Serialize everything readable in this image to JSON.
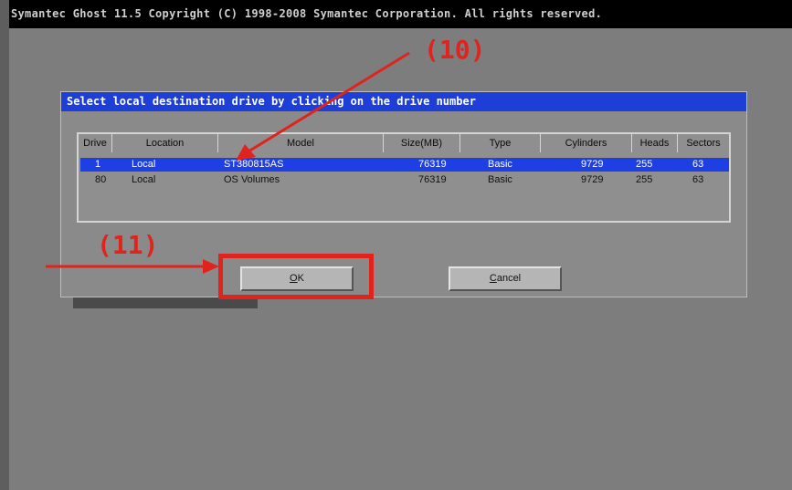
{
  "window": {
    "title": "Symantec Ghost 11.5   Copyright (C) 1998-2008 Symantec Corporation. All rights reserved."
  },
  "dialog": {
    "title": "Select local destination drive by clicking on the drive number",
    "columns": [
      "Drive",
      "Location",
      "Model",
      "Size(MB)",
      "Type",
      "Cylinders",
      "Heads",
      "Sectors"
    ],
    "rows": [
      {
        "drive": "1",
        "location": "Local",
        "model": "ST380815AS",
        "size": "76319",
        "type": "Basic",
        "cylinders": "9729",
        "heads": "255",
        "sectors": "63",
        "selected": true
      },
      {
        "drive": "80",
        "location": "Local",
        "model": "OS Volumes",
        "size": "76319",
        "type": "Basic",
        "cylinders": "9729",
        "heads": "255",
        "sectors": "63",
        "selected": false
      }
    ],
    "ok_label": {
      "underlined": "O",
      "rest": "K"
    },
    "cancel_label": {
      "underlined": "C",
      "rest": "ancel"
    }
  },
  "annotations": {
    "step10": "(10)",
    "step11": "(11)",
    "color": "#e0231d"
  },
  "colors": {
    "header_blue": "#1d3fd8",
    "selection_blue": "#1e3fe4",
    "background_gray": "#7d7d7d"
  }
}
